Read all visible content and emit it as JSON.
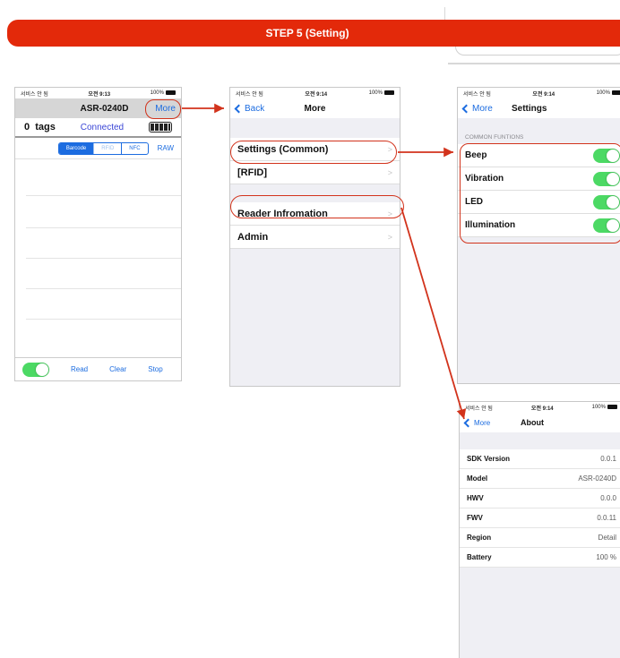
{
  "banner": "STEP 5 (Setting)",
  "status": {
    "carrier": "서비스 안 됨",
    "time1": "오전 9:13",
    "time2": "오전 9:14",
    "battery": "100%"
  },
  "screen1": {
    "title": "ASR-0240D",
    "more": "More",
    "tags_count": "0",
    "tags_label": "tags",
    "connection": "Connected",
    "tabs": [
      "Barcode",
      "RFID",
      "NFC"
    ],
    "raw": "RAW",
    "read": "Read",
    "clear": "Clear",
    "stop": "Stop"
  },
  "screen2": {
    "back": "Back",
    "title": "More",
    "items": [
      "Settings (Common)",
      "[RFID]",
      "Reader Infromation",
      "Admin"
    ]
  },
  "screen3": {
    "back": "More",
    "title": "Settings",
    "section": "COMMON FUNTIONS",
    "items": [
      "Beep",
      "Vibration",
      "LED",
      "Illumination"
    ]
  },
  "screen4": {
    "back": "More",
    "title": "About",
    "rows": [
      {
        "k": "SDK Version",
        "v": "0.0.1"
      },
      {
        "k": "Model",
        "v": "ASR-0240D"
      },
      {
        "k": "HWV",
        "v": "0.0.0"
      },
      {
        "k": "FWV",
        "v": "0.0.11"
      },
      {
        "k": "Region",
        "v": "Detail"
      },
      {
        "k": "Battery",
        "v": "100 %"
      }
    ]
  },
  "colors": {
    "accent": "#1c6ce0",
    "banner": "#e3290a",
    "toggle_on": "#4cd964",
    "callout": "#d2331c"
  }
}
